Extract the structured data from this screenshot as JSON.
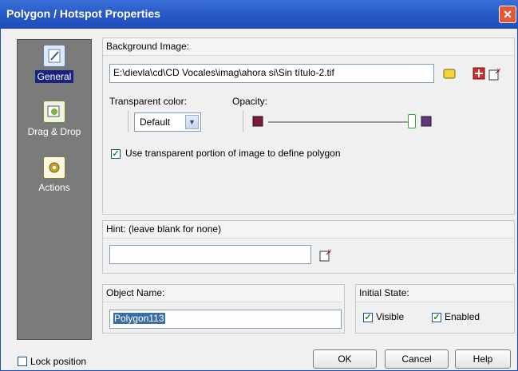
{
  "window": {
    "title": "Polygon / Hotspot Properties"
  },
  "nav": {
    "items": [
      {
        "label": "General"
      },
      {
        "label": "Drag & Drop"
      },
      {
        "label": "Actions"
      }
    ]
  },
  "background_image": {
    "header": "Background Image:",
    "value": "E:\\dievla\\cd\\CD Vocales\\imag\\ahora si\\Sin título-2.tif",
    "transparent_color_label": "Transparent color:",
    "transparent_color_value": "Default",
    "opacity_label": "Opacity:",
    "opacity_fraction": 1.0,
    "use_transparent_label": "Use transparent portion of image to define polygon",
    "use_transparent_checked": true
  },
  "hint": {
    "header": "Hint: (leave blank for none)",
    "value": ""
  },
  "object_name": {
    "header": "Object Name:",
    "value": "Polygon113"
  },
  "initial_state": {
    "header": "Initial State:",
    "visible_label": "Visible",
    "visible_checked": true,
    "enabled_label": "Enabled",
    "enabled_checked": true
  },
  "footer": {
    "lock_position_label": "Lock position",
    "lock_position_checked": false,
    "ok_label": "OK",
    "cancel_label": "Cancel",
    "help_label": "Help"
  },
  "colors": {
    "titlebar": "#2556c4",
    "selection": "#1a237e",
    "check": "#1e8a1e"
  }
}
